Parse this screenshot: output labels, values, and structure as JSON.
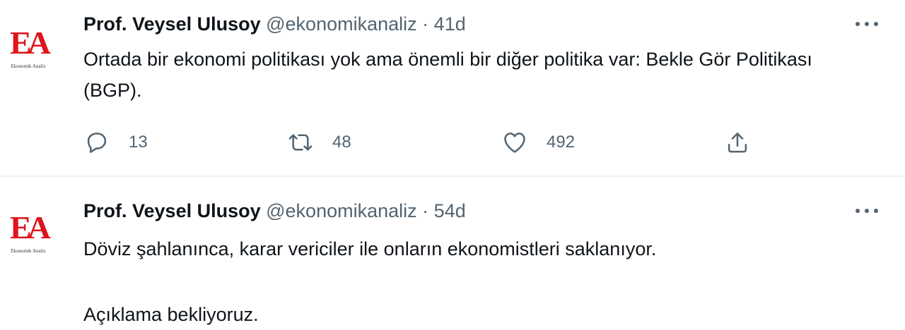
{
  "colors": {
    "accent_red": "#e0141c",
    "text": "#0f1419",
    "muted": "#536471",
    "divider": "#eff3f4"
  },
  "tweets": [
    {
      "avatar": {
        "monogram": "EA",
        "caption": "Ekonomik Analiz"
      },
      "name": "Prof. Veysel Ulusoy",
      "handle": "@ekonomikanaliz",
      "separator": "·",
      "time": "41d",
      "lines": [
        "Ortada bir ekonomi politikası yok ama önemli bir diğer politika var: Bekle Gör Politikası (BGP)."
      ],
      "actions": {
        "reply_count": "13",
        "retweet_count": "48",
        "like_count": "492"
      },
      "icons": [
        "more-icon",
        "reply-icon",
        "retweet-icon",
        "like-icon",
        "share-icon"
      ]
    },
    {
      "avatar": {
        "monogram": "EA",
        "caption": "Ekonomik Analiz"
      },
      "name": "Prof. Veysel Ulusoy",
      "handle": "@ekonomikanaliz",
      "separator": "·",
      "time": "54d",
      "lines": [
        "Döviz şahlanınca, karar vericiler ile onların ekonomistleri saklanıyor.",
        "Açıklama bekliyoruz."
      ],
      "icons": [
        "more-icon"
      ]
    }
  ]
}
